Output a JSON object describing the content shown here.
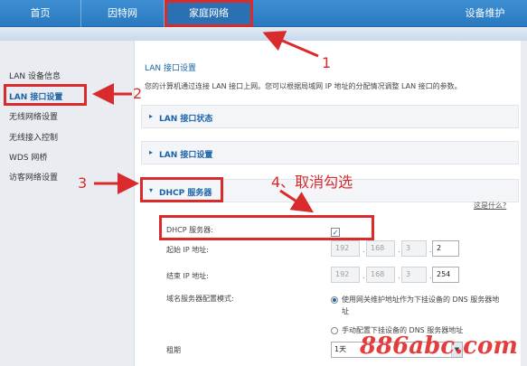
{
  "nav": {
    "items": [
      "首页",
      "因特网",
      "家庭网络"
    ],
    "right": "设备维护"
  },
  "sidebar": {
    "items": [
      "LAN 设备信息",
      "LAN 接口设置",
      "无线网络设置",
      "无线接入控制",
      "WDS 网桥",
      "访客网络设置"
    ],
    "active_index": 1
  },
  "main": {
    "title": "LAN 接口设置",
    "description": "您的计算机通过连接 LAN 接口上网。您可以根据局域网 IP 地址的分配情况调整 LAN 接口的参数。",
    "sections": [
      "LAN 接口状态",
      "LAN 接口设置",
      "DHCP 服务器"
    ],
    "help_link": "这是什么?"
  },
  "dhcp": {
    "server_label": "DHCP 服务器:",
    "checkbox_mark": "✓",
    "start_label": "起始 IP 地址:",
    "end_label": "结束 IP 地址:",
    "start_ip": [
      "192",
      "168",
      "3",
      "2"
    ],
    "end_ip": [
      "192",
      "168",
      "3",
      "254"
    ],
    "dns_mode_label": "域名服务器配置模式:",
    "dns_option_1": "使用网关维护地址作为下挂设备的 DNS 服务器地址",
    "dns_option_2": "手动配置下挂设备的 DNS 服务器地址",
    "lease_label": "租期",
    "lease_value": "1天"
  },
  "annotations": {
    "n1": "1",
    "n2": "2",
    "n3": "3",
    "n4": "4、取消勾选",
    "color": "#d92b2b"
  },
  "watermark": "886abc.com"
}
